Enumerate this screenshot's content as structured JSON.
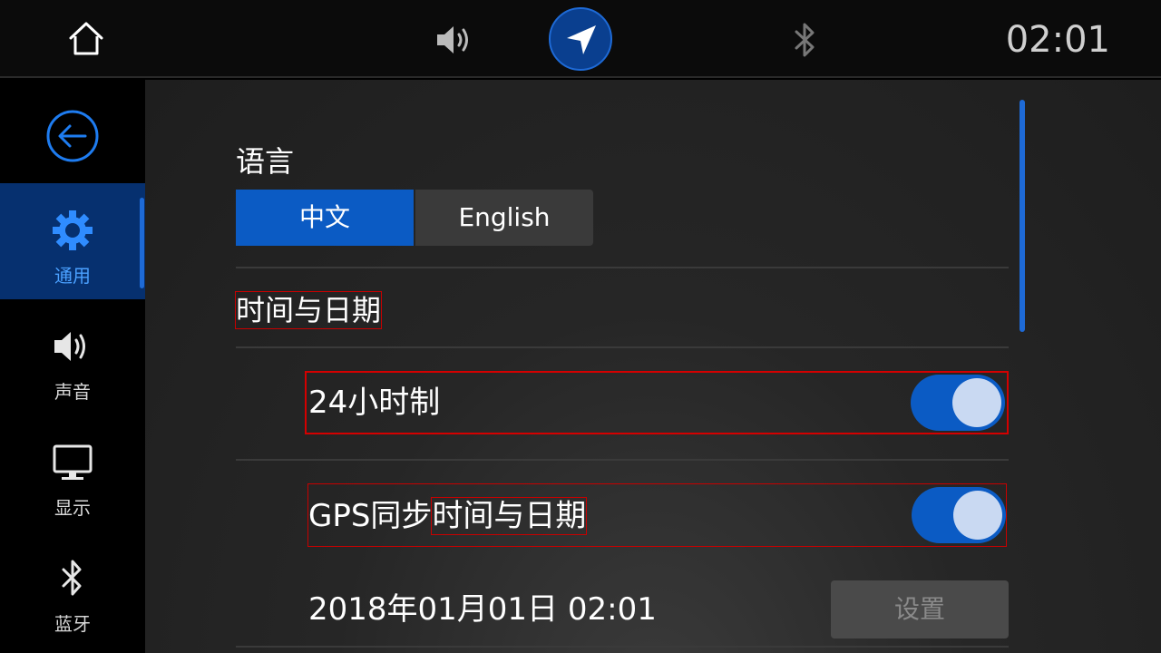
{
  "topbar": {
    "clock": "02:01",
    "icons": {
      "home": "home-icon",
      "volume": "volume-icon",
      "navigation": "navigation-arrow-icon",
      "bluetooth": "bluetooth-icon"
    }
  },
  "sidebar": {
    "items": [
      {
        "label": "通用",
        "icon": "gear-icon",
        "active": true
      },
      {
        "label": "声音",
        "icon": "speaker-icon",
        "active": false
      },
      {
        "label": "显示",
        "icon": "monitor-icon",
        "active": false
      },
      {
        "label": "蓝牙",
        "icon": "bluetooth-icon",
        "active": false
      }
    ]
  },
  "main": {
    "language": {
      "title": "语言",
      "options": [
        "中文",
        "English"
      ],
      "selected": "中文"
    },
    "datetime": {
      "title": "时间与日期",
      "hour24": {
        "label": "24小时制",
        "on": true
      },
      "gps_sync": {
        "prefix": "GPS同步",
        "suffix": "时间与日期",
        "on": true
      },
      "current": "2018年01月01日 02:01",
      "set_button": "设置"
    }
  },
  "colors": {
    "accent": "#0b5bc4",
    "active_sidebar": "#06306f",
    "highlight": "#d40000"
  }
}
